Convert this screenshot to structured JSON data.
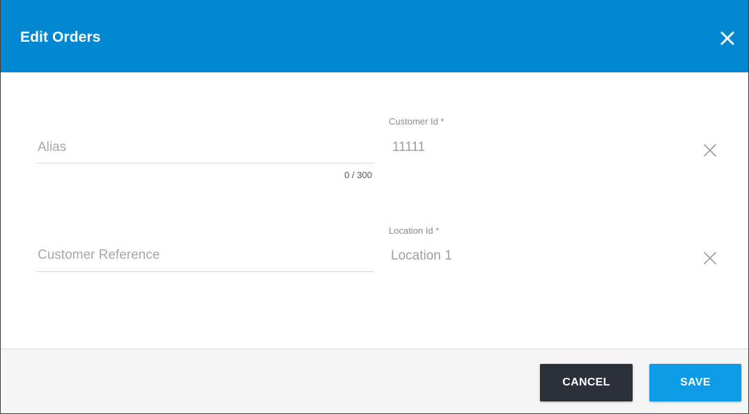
{
  "dialog": {
    "title": "Edit Orders",
    "header_color": "#0288d1",
    "close_icon": "close-icon"
  },
  "form": {
    "alias": {
      "placeholder": "Alias",
      "value": "",
      "counter": "0 / 300"
    },
    "customer_reference": {
      "placeholder": "Customer Reference",
      "value": ""
    },
    "customer_id": {
      "label": "Customer Id *",
      "value": "11111",
      "clear_icon": "clear-icon"
    },
    "location_id": {
      "label": "Location Id *",
      "value": "Location 1",
      "clear_icon": "clear-icon"
    }
  },
  "footer": {
    "cancel_label": "CANCEL",
    "save_label": "SAVE",
    "cancel_color": "#2b3039",
    "save_color": "#0d9be6"
  }
}
